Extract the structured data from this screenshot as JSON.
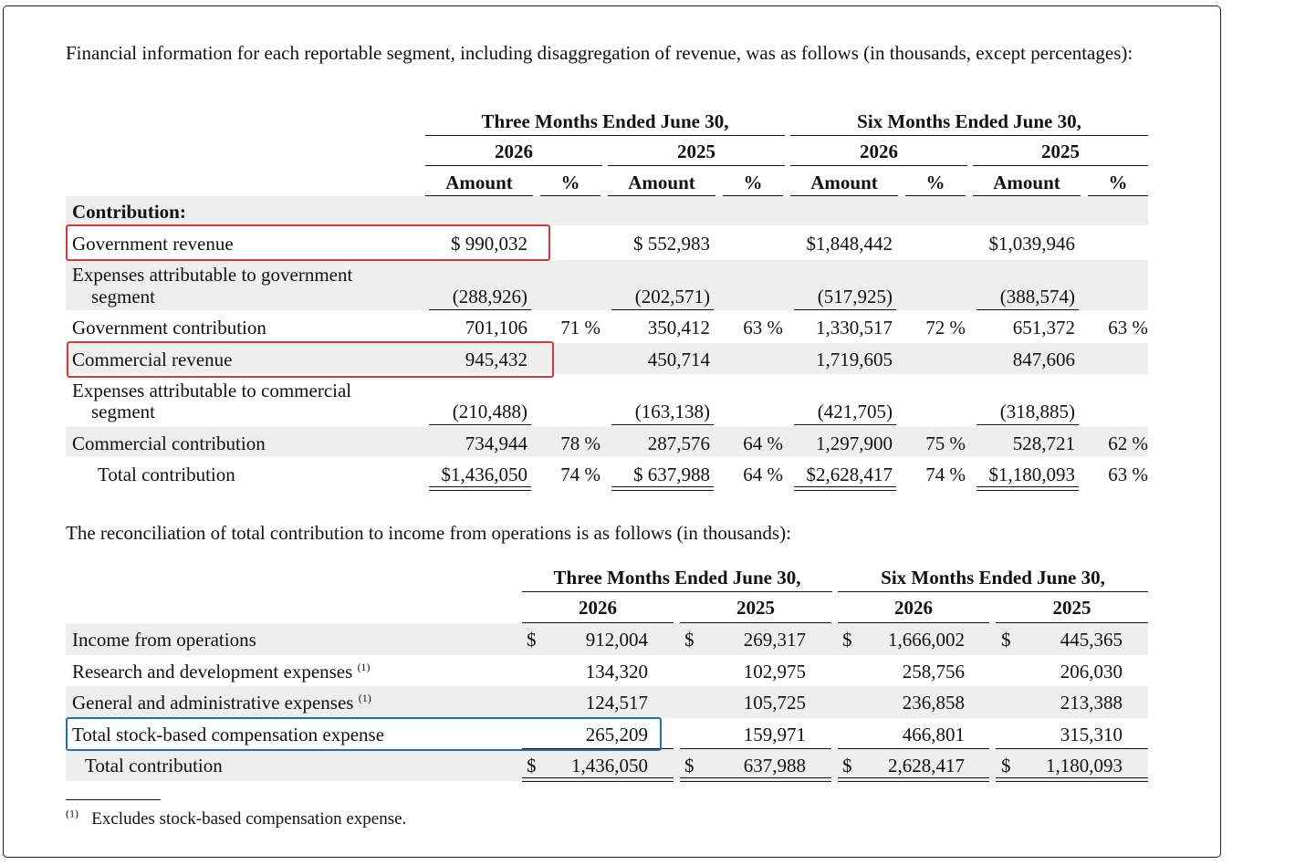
{
  "intro1": "Financial information for each reportable segment, including disaggregation of revenue, was as follows (in thousands, except percentages):",
  "t1": {
    "period_three": "Three Months Ended June 30,",
    "period_six": "Six Months Ended June 30,",
    "year_a": "2026",
    "year_b": "2025",
    "col_amount": "Amount",
    "col_pct": "%",
    "section": "Contribution:",
    "rows": [
      {
        "label": "Government revenue",
        "v": [
          "$ 990,032",
          "",
          "$ 552,983",
          "",
          "$1,848,442",
          "",
          "$1,039,946",
          ""
        ]
      },
      {
        "label": "Expenses attributable to government",
        "label2": "segment",
        "v": [
          "(288,926)",
          "",
          "(202,571)",
          "",
          "(517,925)",
          "",
          "(388,574)",
          ""
        ]
      },
      {
        "label": "Government contribution",
        "v": [
          "701,106",
          "71 %",
          "350,412",
          "63 %",
          "1,330,517",
          "72 %",
          "651,372",
          "63 %"
        ]
      },
      {
        "label": "Commercial revenue",
        "v": [
          "945,432",
          "",
          "450,714",
          "",
          "1,719,605",
          "",
          "847,606",
          ""
        ]
      },
      {
        "label": "Expenses attributable to commercial",
        "label2": "segment",
        "v": [
          "(210,488)",
          "",
          "(163,138)",
          "",
          "(421,705)",
          "",
          "(318,885)",
          ""
        ]
      },
      {
        "label": "Commercial contribution",
        "v": [
          "734,944",
          "78 %",
          "287,576",
          "64 %",
          "1,297,900",
          "75 %",
          "528,721",
          "62 %"
        ]
      },
      {
        "label": "Total contribution",
        "v": [
          "$1,436,050",
          "74 %",
          "$ 637,988",
          "64 %",
          "$2,628,417",
          "74 %",
          "$1,180,093",
          "63 %"
        ]
      }
    ]
  },
  "intro2": "The reconciliation of total contribution to income from operations is as follows (in thousands):",
  "t2": {
    "period_three": "Three Months Ended June 30,",
    "period_six": "Six Months Ended June 30,",
    "year_a": "2026",
    "year_b": "2025",
    "currency": "$",
    "rows": [
      {
        "label": "Income from operations",
        "sup": "",
        "v": [
          "912,004",
          "269,317",
          "1,666,002",
          "445,365"
        ]
      },
      {
        "label": "Research and development expenses",
        "sup": "(1)",
        "v": [
          "134,320",
          "102,975",
          "258,756",
          "206,030"
        ]
      },
      {
        "label": "General and administrative expenses",
        "sup": "(1)",
        "v": [
          "124,517",
          "105,725",
          "236,858",
          "213,388"
        ]
      },
      {
        "label": "Total stock-based compensation expense",
        "sup": "",
        "v": [
          "265,209",
          "159,971",
          "466,801",
          "315,310"
        ]
      },
      {
        "label": "Total contribution",
        "sup": "",
        "v": [
          "1,436,050",
          "637,988",
          "2,628,417",
          "1,180,093"
        ]
      }
    ]
  },
  "footnote": {
    "marker": "(1)",
    "text": "Excludes stock-based compensation expense."
  }
}
